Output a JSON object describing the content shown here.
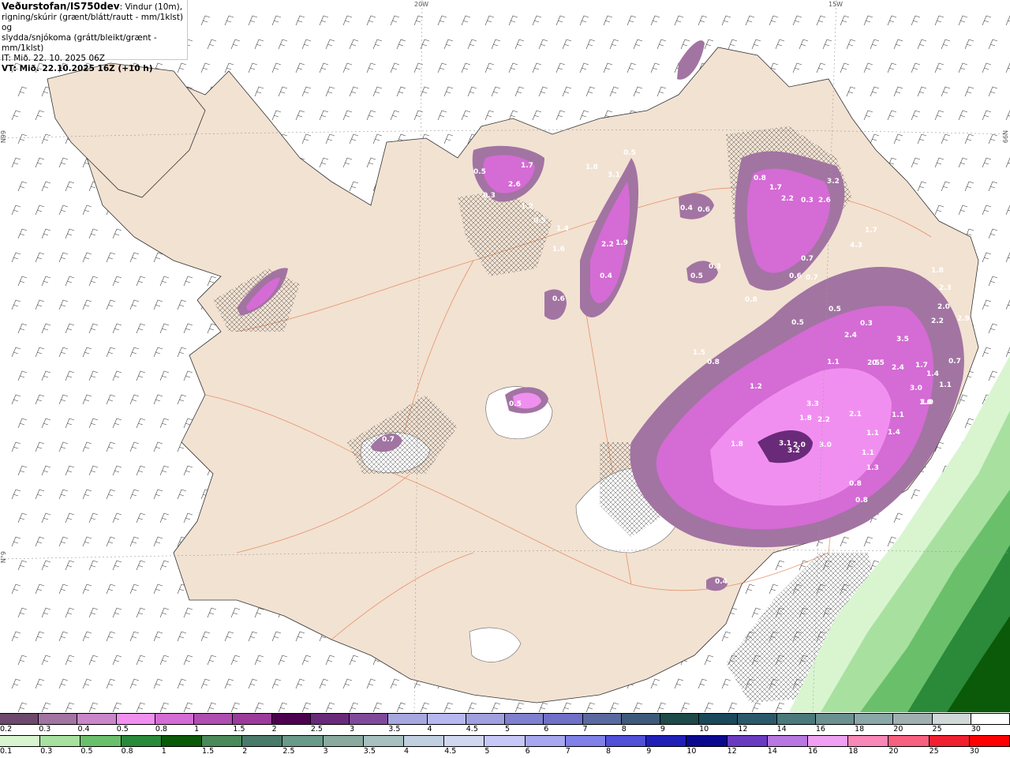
{
  "title": {
    "bold": "Veðurstofan/IS750dev",
    "rest": ": Vindur (10m),",
    "line2": "rigning/skúrir (grænt/blátt/rautt - mm/1klst) og",
    "line3": "slydda/snjókoma (grátt/bleikt/grænt - mm/1klst)",
    "line4": "IT: Mið. 22. 10. 2025 06Z",
    "line5": "VT: Mið. 22.10.2025 16Z (+10 h)"
  },
  "grid_labels": {
    "top_a": "20W",
    "top_b": "15W",
    "left_a": "N99",
    "left_b": "N°9",
    "right_a": "N99"
  },
  "legend_top": {
    "labels": [
      "0.2",
      "0.3",
      "0.4",
      "0.5",
      "0.8",
      "1",
      "1.5",
      "2",
      "2.5",
      "3",
      "3.5",
      "4",
      "4.5",
      "5",
      "6",
      "7",
      "8",
      "9",
      "10",
      "12",
      "14",
      "16",
      "18",
      "20",
      "25",
      "30"
    ],
    "colors": [
      "#6d4a6d",
      "#a274a2",
      "#c987c9",
      "#f18ff1",
      "#d56bd5",
      "#b04db0",
      "#9c3b9c",
      "#4d0050",
      "#6a2a7a",
      "#7f4a9c",
      "#a8a8e0",
      "#b8b8f0",
      "#a0a0e0",
      "#8080d0",
      "#7070c8",
      "#5a6aa0",
      "#3d5a7a",
      "#1e4a4a",
      "#1a4a5a",
      "#2a5a6a",
      "#4a7a7a",
      "#6a9090",
      "#8aa8a8",
      "#a0b0b0",
      "#d0d8d8",
      "#ffffff"
    ]
  },
  "legend_bottom": {
    "labels": [
      "0.1",
      "0.3",
      "0.5",
      "0.8",
      "1",
      "1.5",
      "2",
      "2.5",
      "3",
      "3.5",
      "4",
      "4.5",
      "5",
      "6",
      "7",
      "8",
      "9",
      "10",
      "12",
      "14",
      "16",
      "18",
      "20",
      "25",
      "30"
    ],
    "colors": [
      "#d8f5d0",
      "#a8e0a0",
      "#6ac06a",
      "#2a8a3a",
      "#0a5a0a",
      "#4a8a5a",
      "#4a7a6a",
      "#6a9a8a",
      "#8aaaa0",
      "#a8c0c0",
      "#c0d0e0",
      "#d0d8f0",
      "#c8c8f8",
      "#a8a8f0",
      "#8080e8",
      "#5050d8",
      "#2020b8",
      "#0a0a90",
      "#6a3ac0",
      "#b878e0",
      "#f0a0f0",
      "#f888b8",
      "#f86080",
      "#f02030",
      "#ff0000"
    ]
  },
  "precip_values": [
    "0.5",
    "1.7",
    "2.6",
    "0.3",
    "1.2",
    "0.5",
    "3.1",
    "1.8",
    "0.5",
    "0.8",
    "1.7",
    "2.2",
    "0.3",
    "2.6",
    "3.2",
    "0.4",
    "0.6",
    "0.3",
    "0.5",
    "0.4",
    "1.9",
    "2.2",
    "1.4",
    "1.6",
    "0.6",
    "0.7",
    "4.3",
    "1.7",
    "0.7",
    "1.8",
    "2.3",
    "2.0",
    "2.2",
    "2.9",
    "1.6",
    "0.7",
    "0.6",
    "0.5",
    "0.8",
    "0.5",
    "0.3",
    "0.5",
    "2.4",
    "1.5",
    "1.1",
    "3.5",
    "1.7",
    "1.4",
    "1.1",
    "1.0",
    "0.8",
    "1.2",
    "3.3",
    "1.8",
    "2.2",
    "2.1",
    "1.1",
    "1.4",
    "1.1",
    "1.8",
    "3.1",
    "2.0",
    "3.2",
    "3.0",
    "1.1",
    "1.3",
    "0.8",
    "0.8",
    "0.5",
    "0.7",
    "0.4",
    "2.5",
    "2.4",
    "3.0",
    "1.0"
  ]
}
